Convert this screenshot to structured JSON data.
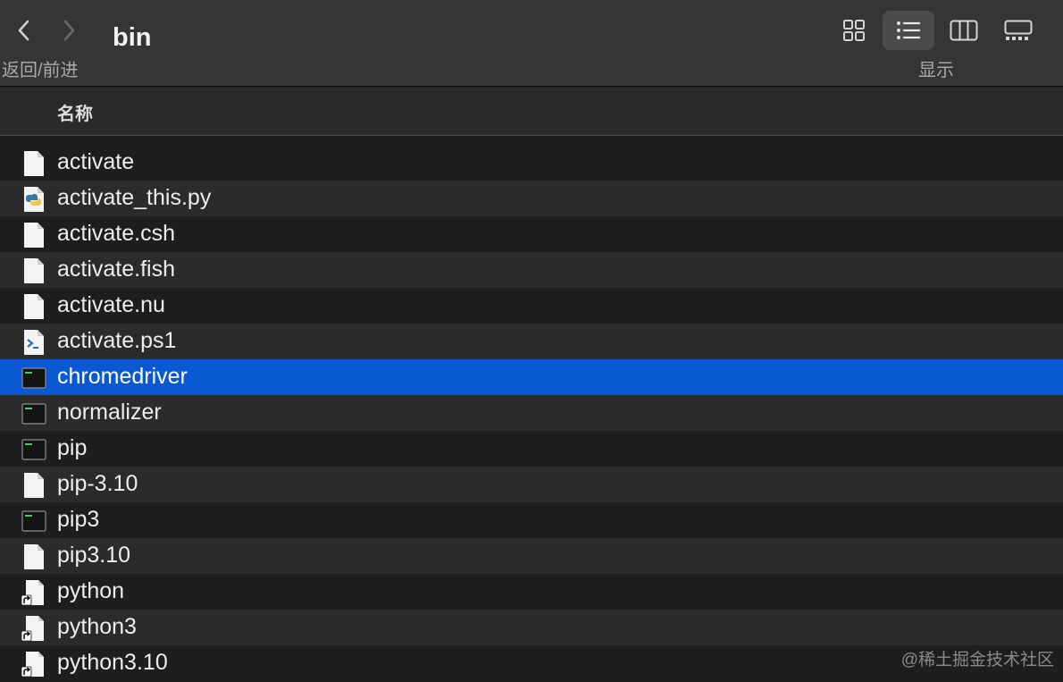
{
  "toolbar": {
    "title": "bin",
    "nav_label": "返回/前进",
    "display_label": "显示",
    "views": [
      {
        "name": "icon-view",
        "active": false
      },
      {
        "name": "list-view",
        "active": true
      },
      {
        "name": "column-view",
        "active": false
      },
      {
        "name": "gallery-view",
        "active": false
      }
    ]
  },
  "columns": {
    "name": "名称"
  },
  "files": [
    {
      "name": "activate",
      "icon": "document-icon",
      "selected": false
    },
    {
      "name": "activate_this.py",
      "icon": "python-file-icon",
      "selected": false
    },
    {
      "name": "activate.csh",
      "icon": "document-icon",
      "selected": false
    },
    {
      "name": "activate.fish",
      "icon": "document-icon",
      "selected": false
    },
    {
      "name": "activate.nu",
      "icon": "document-icon",
      "selected": false
    },
    {
      "name": "activate.ps1",
      "icon": "powershell-file-icon",
      "selected": false
    },
    {
      "name": "chromedriver",
      "icon": "executable-icon",
      "selected": true
    },
    {
      "name": "normalizer",
      "icon": "executable-icon",
      "selected": false
    },
    {
      "name": "pip",
      "icon": "executable-icon",
      "selected": false
    },
    {
      "name": "pip-3.10",
      "icon": "document-icon",
      "selected": false
    },
    {
      "name": "pip3",
      "icon": "executable-icon",
      "selected": false
    },
    {
      "name": "pip3.10",
      "icon": "document-icon",
      "selected": false
    },
    {
      "name": "python",
      "icon": "alias-icon",
      "selected": false
    },
    {
      "name": "python3",
      "icon": "alias-icon",
      "selected": false
    },
    {
      "name": "python3.10",
      "icon": "alias-icon",
      "selected": false
    }
  ],
  "watermark": "@稀土掘金技术社区",
  "colors": {
    "selection": "#0b59d2",
    "toolbar": "#353535",
    "background": "#1e1e1e"
  }
}
